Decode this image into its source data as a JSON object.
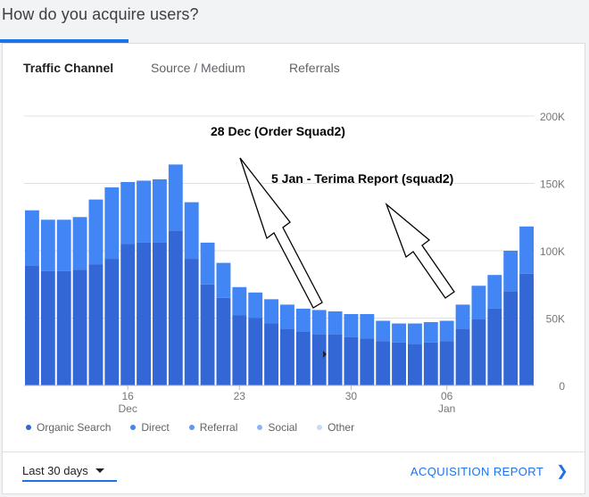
{
  "page": {
    "title": "How do you acquire users?"
  },
  "tabs": [
    {
      "label": "Traffic Channel",
      "active": true
    },
    {
      "label": "Source / Medium",
      "active": false
    },
    {
      "label": "Referrals",
      "active": false
    }
  ],
  "annotations": [
    {
      "text": "28 Dec (Order Squad2)"
    },
    {
      "text": "5 Jan - Terima Report (squad2)"
    }
  ],
  "legend": [
    {
      "label": "Organic Search",
      "color": "#3367d6"
    },
    {
      "label": "Direct",
      "color": "#4285f4"
    },
    {
      "label": "Referral",
      "color": "#5e97f6"
    },
    {
      "label": "Social",
      "color": "#8ab4f8"
    },
    {
      "label": "Other",
      "color": "#c6dafc"
    }
  ],
  "footer": {
    "range_label": "Last 30 days",
    "report_link": "ACQUISITION REPORT"
  },
  "colors": {
    "accent": "#1a73e8",
    "organic": "#3367d6",
    "direct": "#4285f4"
  },
  "chart_data": {
    "type": "bar",
    "stacked": true,
    "y_ticks": [
      "200K",
      "150K",
      "100K",
      "50K",
      "0"
    ],
    "ylim": [
      0,
      200000
    ],
    "x_tick_labels": [
      {
        "index": 6,
        "label": "16",
        "sublabel": "Dec"
      },
      {
        "index": 13,
        "label": "23",
        "sublabel": ""
      },
      {
        "index": 20,
        "label": "30",
        "sublabel": ""
      },
      {
        "index": 26,
        "label": "06",
        "sublabel": "Jan"
      }
    ],
    "grid": true,
    "series": [
      {
        "name": "Organic Search",
        "values": [
          89000,
          85000,
          85000,
          86000,
          90000,
          94000,
          105000,
          106000,
          106000,
          115000,
          94000,
          75000,
          65000,
          52000,
          50000,
          46000,
          42000,
          40000,
          38000,
          38000,
          36000,
          35000,
          33000,
          32000,
          31000,
          32000,
          33000,
          42000,
          49000,
          57000,
          70000,
          83000
        ]
      },
      {
        "name": "Direct",
        "values": [
          41000,
          38000,
          38000,
          39000,
          48000,
          53000,
          46000,
          46000,
          47000,
          49000,
          42000,
          31000,
          26000,
          21000,
          19000,
          18000,
          18000,
          17000,
          18000,
          17000,
          17000,
          18000,
          15000,
          14000,
          15000,
          15000,
          15000,
          18000,
          25000,
          25000,
          30000,
          35000
        ]
      }
    ]
  }
}
